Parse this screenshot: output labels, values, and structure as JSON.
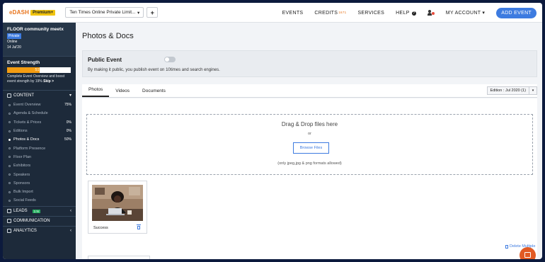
{
  "app": {
    "logo": "eDASH",
    "plan_badge": "Premium+",
    "org_selector": "Ten Times Online Private Limit...",
    "plus_label": "+"
  },
  "nav": {
    "events": "EVENTS",
    "credits": "CREDITS",
    "credits_count": "1671",
    "services": "SERVICES",
    "help": "HELP",
    "help_icon": "?",
    "my_account": "MY ACCOUNT ▾",
    "add_event": "ADD EVENT"
  },
  "sidebar": {
    "event_name": "FLOOR community meetx",
    "privacy": "Private",
    "mode": "Online",
    "date": "14 Jul'20",
    "strength_title": "Event Strength",
    "strength_percent": "51%",
    "strength_value": 0.51,
    "strength_note": "Complete Event Overview and boost event strength by 19%",
    "skip": "Skip >",
    "content_section": "CONTENT",
    "content_items": [
      {
        "label": "Event Overview",
        "pct": "75%"
      },
      {
        "label": "Agenda & Schedule",
        "pct": ""
      },
      {
        "label": "Tickets & Prices",
        "pct": "0%"
      },
      {
        "label": "Editions",
        "pct": "0%"
      },
      {
        "label": "Photos & Docs",
        "pct": "50%"
      },
      {
        "label": "Platform Presence",
        "pct": ""
      },
      {
        "label": "Floor Plan",
        "pct": ""
      },
      {
        "label": "Exhibitors",
        "pct": ""
      },
      {
        "label": "Speakers",
        "pct": ""
      },
      {
        "label": "Sponsors",
        "pct": ""
      },
      {
        "label": "Bulk Import",
        "pct": ""
      },
      {
        "label": "Social Feeds",
        "pct": ""
      }
    ],
    "leads": "LEADS",
    "leads_badge": "1 N",
    "communication": "COMMUNICATION",
    "analytics": "ANALYTICS"
  },
  "main": {
    "page_title": "Photos & Docs",
    "public_title": "Public Event",
    "public_desc": "By making it public, you publish event on 10times and search engines.",
    "tabs": [
      "Photos",
      "Videos",
      "Documents"
    ],
    "edition": "Edition : Jul 2020 (1)",
    "dropzone_title": "Drag & Drop files here",
    "dropzone_or": "or",
    "browse": "Browse Files",
    "dropzone_note": "(only jpeg,jpg & png formats allowed)",
    "photo_caption": "Success",
    "delete_multiple": "Delete Multiple"
  }
}
